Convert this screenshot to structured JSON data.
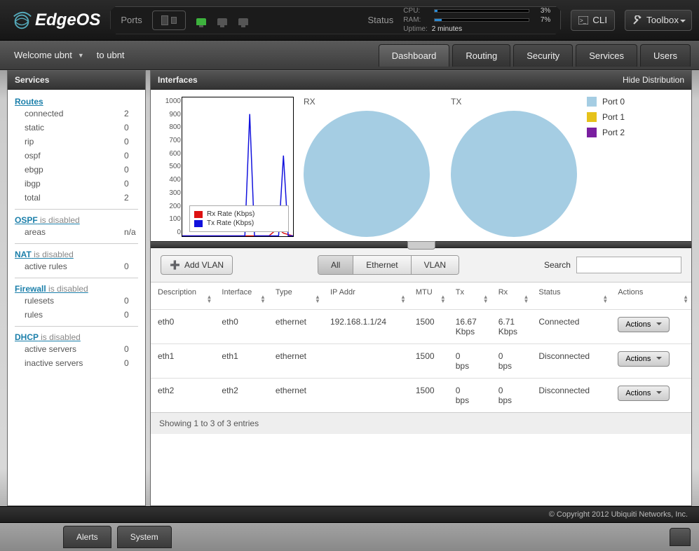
{
  "brand": "EdgeOS",
  "topbar": {
    "ports_label": "Ports",
    "status_label": "Status",
    "cli_label": "CLI",
    "toolbox_label": "Toolbox",
    "metrics": {
      "cpu_label": "CPU:",
      "cpu_pct": "3%",
      "cpu_fill": 3,
      "ram_label": "RAM:",
      "ram_pct": "7%",
      "ram_fill": 7,
      "uptime_label": "Uptime:",
      "uptime_value": "2 minutes"
    }
  },
  "secondbar": {
    "welcome": "Welcome ubnt",
    "to_label": "to ubnt",
    "tabs": [
      "Dashboard",
      "Routing",
      "Security",
      "Services",
      "Users"
    ],
    "active_tab": "Dashboard"
  },
  "sidebar": {
    "header": "Services",
    "sections": {
      "routes": {
        "title": "Routes",
        "rows": [
          {
            "k": "connected",
            "v": "2"
          },
          {
            "k": "static",
            "v": "0"
          },
          {
            "k": "rip",
            "v": "0"
          },
          {
            "k": "ospf",
            "v": "0"
          },
          {
            "k": "ebgp",
            "v": "0"
          },
          {
            "k": "ibgp",
            "v": "0"
          },
          {
            "k": "total",
            "v": "2"
          }
        ]
      },
      "ospf": {
        "title": "OSPF",
        "suffix": "is disabled",
        "rows": [
          {
            "k": "areas",
            "v": "n/a"
          }
        ]
      },
      "nat": {
        "title": "NAT",
        "suffix": "is disabled",
        "rows": [
          {
            "k": "active rules",
            "v": "0"
          }
        ]
      },
      "firewall": {
        "title": "Firewall",
        "suffix": "is disabled",
        "rows": [
          {
            "k": "rulesets",
            "v": "0"
          },
          {
            "k": "rules",
            "v": "0"
          }
        ]
      },
      "dhcp": {
        "title": "DHCP",
        "suffix": "is disabled",
        "rows": [
          {
            "k": "active servers",
            "v": "0"
          },
          {
            "k": "inactive servers",
            "v": "0"
          }
        ]
      }
    }
  },
  "content": {
    "header_title": "Interfaces",
    "header_link": "Hide Distribution",
    "chart_labels": {
      "rx": "RX",
      "tx": "TX"
    },
    "line_legend": {
      "rx": "Rx Rate (Kbps)",
      "tx": "Tx Rate (Kbps)"
    },
    "port_legend": [
      {
        "label": "Port 0",
        "color": "#a5cde3"
      },
      {
        "label": "Port 1",
        "color": "#e6c21a"
      },
      {
        "label": "Port 2",
        "color": "#7a1fa0"
      }
    ],
    "toolbar": {
      "add_vlan": "Add VLAN",
      "filters": [
        "All",
        "Ethernet",
        "VLAN"
      ],
      "active_filter": "All",
      "search_label": "Search"
    },
    "columns": [
      "Description",
      "Interface",
      "Type",
      "IP Addr",
      "MTU",
      "Tx",
      "Rx",
      "Status",
      "Actions"
    ],
    "rows": [
      {
        "desc": "eth0",
        "iface": "eth0",
        "type": "ethernet",
        "ip": "192.168.1.1/24",
        "mtu": "1500",
        "tx": "16.67 Kbps",
        "rx": "6.71 Kbps",
        "status": "Connected",
        "status_class": "status-connected"
      },
      {
        "desc": "eth1",
        "iface": "eth1",
        "type": "ethernet",
        "ip": "",
        "mtu": "1500",
        "tx": "0 bps",
        "rx": "0 bps",
        "status": "Disconnected",
        "status_class": "status-disconnected"
      },
      {
        "desc": "eth2",
        "iface": "eth2",
        "type": "ethernet",
        "ip": "",
        "mtu": "1500",
        "tx": "0 bps",
        "rx": "0 bps",
        "status": "Disconnected",
        "status_class": "status-disconnected"
      }
    ],
    "actions_label": "Actions",
    "entries_text": "Showing 1 to 3 of 3 entries"
  },
  "footer": {
    "copyright": "© Copyright 2012 Ubiquiti Networks, Inc.",
    "alerts": "Alerts",
    "system": "System"
  },
  "chart_data": {
    "type": "line",
    "xlabel": "",
    "ylabel": "",
    "ylim": [
      0,
      1000
    ],
    "yticks": [
      0,
      100,
      200,
      300,
      400,
      500,
      600,
      700,
      800,
      900,
      1000
    ],
    "series": [
      {
        "name": "Rx Rate (Kbps)",
        "color": "#d11",
        "values": [
          0,
          0,
          0,
          0,
          0,
          0,
          0,
          0,
          0,
          0,
          0,
          0,
          0,
          0,
          0,
          0,
          0,
          0,
          0,
          30,
          50,
          20,
          10,
          0
        ]
      },
      {
        "name": "Tx Rate (Kbps)",
        "color": "#11d",
        "values": [
          0,
          0,
          0,
          0,
          0,
          0,
          0,
          0,
          0,
          0,
          0,
          0,
          0,
          0,
          880,
          0,
          0,
          0,
          0,
          0,
          0,
          580,
          0,
          0
        ]
      }
    ]
  }
}
